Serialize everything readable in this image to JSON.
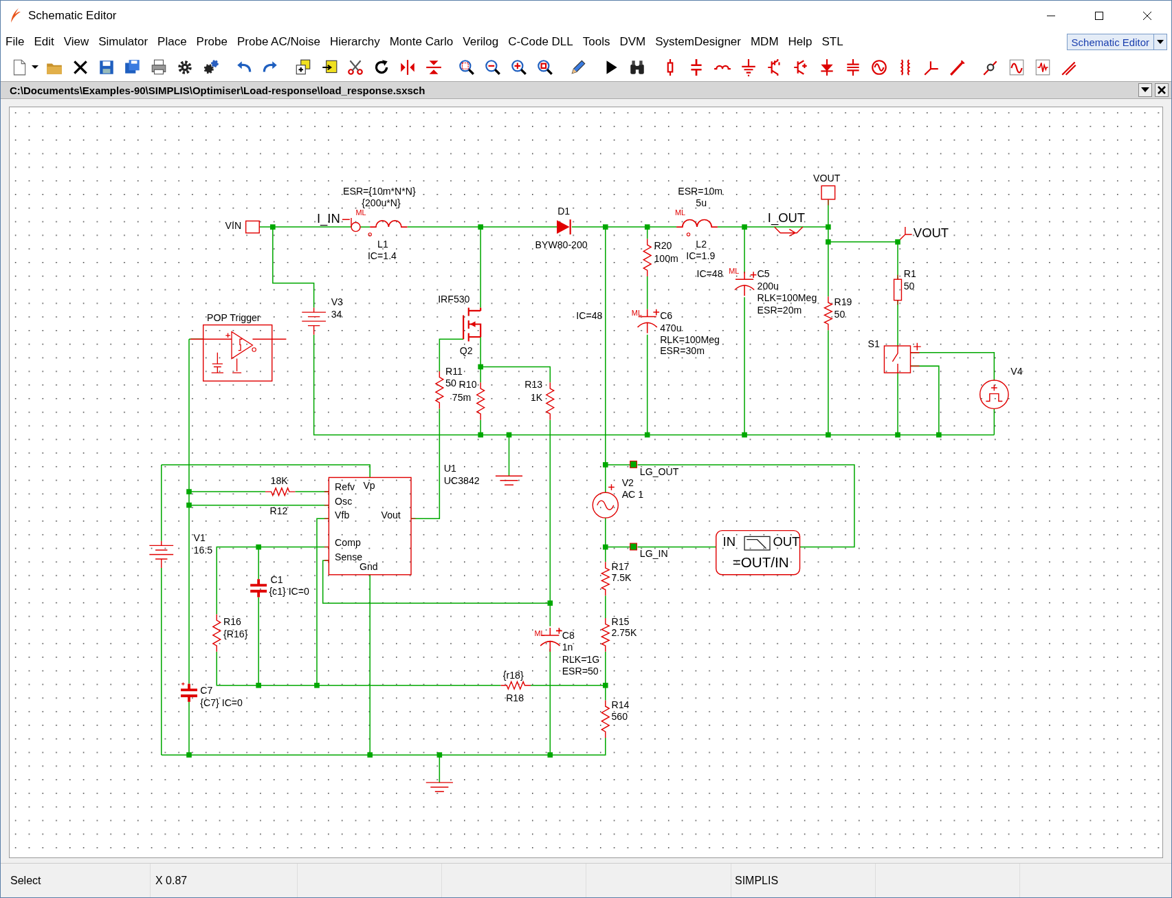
{
  "window": {
    "title": "Schematic Editor"
  },
  "menu": [
    "File",
    "Edit",
    "View",
    "Simulator",
    "Place",
    "Probe",
    "Probe AC/Noise",
    "Hierarchy",
    "Monte Carlo",
    "Verilog",
    "C-Code DLL",
    "Tools",
    "DVM",
    "SystemDesigner",
    "MDM",
    "Help",
    "STL"
  ],
  "mode_selector": {
    "value": "Schematic Editor"
  },
  "document": {
    "path": "C:\\Documents\\Examples-90\\SIMPLIS\\Optimiser\\Load-response\\load_response.sxsch"
  },
  "schematic": {
    "labels": [
      {
        "text": "VIN",
        "kind": "label"
      },
      {
        "text": "ESR={10m*N*N}",
        "kind": "label"
      },
      {
        "text": "{200u*N}",
        "kind": "label"
      },
      {
        "text": "I_IN",
        "kind": "net"
      },
      {
        "text": "ML",
        "kind": "ml"
      },
      {
        "text": "L1",
        "kind": "label"
      },
      {
        "text": "IC=1.4",
        "kind": "label"
      },
      {
        "text": "D1",
        "kind": "label"
      },
      {
        "text": "BYW80-200",
        "kind": "label"
      },
      {
        "text": "ESR=10m",
        "kind": "label"
      },
      {
        "text": "5u",
        "kind": "label"
      },
      {
        "text": "ML",
        "kind": "ml"
      },
      {
        "text": "L2",
        "kind": "label"
      },
      {
        "text": "IC=1.9",
        "kind": "label"
      },
      {
        "text": "VOUT",
        "kind": "label"
      },
      {
        "text": "I_OUT",
        "kind": "net"
      },
      {
        "text": "VOUT",
        "kind": "net"
      },
      {
        "text": "R20",
        "kind": "label"
      },
      {
        "text": "100m",
        "kind": "label"
      },
      {
        "text": "IC=48",
        "kind": "label"
      },
      {
        "text": "ML",
        "kind": "ml"
      },
      {
        "text": "C5",
        "kind": "label"
      },
      {
        "text": "200u",
        "kind": "label"
      },
      {
        "text": "RLK=100Meg",
        "kind": "label"
      },
      {
        "text": "ESR=20m",
        "kind": "label"
      },
      {
        "text": "R1",
        "kind": "label"
      },
      {
        "text": "50",
        "kind": "label"
      },
      {
        "text": "R19",
        "kind": "label"
      },
      {
        "text": "50",
        "kind": "label"
      },
      {
        "text": "S1",
        "kind": "label"
      },
      {
        "text": "V4",
        "kind": "label"
      },
      {
        "text": "V3",
        "kind": "label"
      },
      {
        "text": "34",
        "kind": "label"
      },
      {
        "text": "POP Trigger",
        "kind": "label"
      },
      {
        "text": "IRF530",
        "kind": "label"
      },
      {
        "text": "Q2",
        "kind": "label"
      },
      {
        "text": "IC=48",
        "kind": "label"
      },
      {
        "text": "ML",
        "kind": "ml"
      },
      {
        "text": "C6",
        "kind": "label"
      },
      {
        "text": "470u",
        "kind": "label"
      },
      {
        "text": "RLK=100Meg",
        "kind": "label"
      },
      {
        "text": "ESR=30m",
        "kind": "label"
      },
      {
        "text": "R11",
        "kind": "label"
      },
      {
        "text": "50",
        "kind": "label"
      },
      {
        "text": "R10",
        "kind": "label"
      },
      {
        "text": "75m",
        "kind": "label"
      },
      {
        "text": "R13",
        "kind": "label"
      },
      {
        "text": "1K",
        "kind": "label"
      },
      {
        "text": "U1",
        "kind": "label"
      },
      {
        "text": "UC3842",
        "kind": "label"
      },
      {
        "text": "LG_OUT",
        "kind": "label"
      },
      {
        "text": "18K",
        "kind": "label"
      },
      {
        "text": "R12",
        "kind": "label"
      },
      {
        "text": "Refv",
        "kind": "pin"
      },
      {
        "text": "Vp",
        "kind": "pin"
      },
      {
        "text": "Osc",
        "kind": "pin"
      },
      {
        "text": "Vfb",
        "kind": "pin"
      },
      {
        "text": "Vout",
        "kind": "pin"
      },
      {
        "text": "Comp",
        "kind": "pin"
      },
      {
        "text": "Sense",
        "kind": "pin"
      },
      {
        "text": "Gnd",
        "kind": "pin"
      },
      {
        "text": "V2",
        "kind": "label"
      },
      {
        "text": "AC 1",
        "kind": "label"
      },
      {
        "text": "V1",
        "kind": "label"
      },
      {
        "text": "16.5",
        "kind": "label"
      },
      {
        "text": "LG_IN",
        "kind": "label"
      },
      {
        "text": "IN",
        "kind": "block"
      },
      {
        "text": "OUT",
        "kind": "block"
      },
      {
        "text": "=OUT/IN",
        "kind": "block"
      },
      {
        "text": "R17",
        "kind": "label"
      },
      {
        "text": "7.5K",
        "kind": "label"
      },
      {
        "text": "C1",
        "kind": "label"
      },
      {
        "text": "{c1} IC=0",
        "kind": "label"
      },
      {
        "text": "R16",
        "kind": "label"
      },
      {
        "text": "{R16}",
        "kind": "label"
      },
      {
        "text": "R15",
        "kind": "label"
      },
      {
        "text": "ML",
        "kind": "ml"
      },
      {
        "text": "C8",
        "kind": "label"
      },
      {
        "text": "2.75K",
        "kind": "label"
      },
      {
        "text": "1n",
        "kind": "label"
      },
      {
        "text": "RLK=1G",
        "kind": "label"
      },
      {
        "text": "ESR=50",
        "kind": "label"
      },
      {
        "text": "{r18}",
        "kind": "label"
      },
      {
        "text": "R18",
        "kind": "label"
      },
      {
        "text": "C7",
        "kind": "label"
      },
      {
        "text": "{C7} IC=0",
        "kind": "label"
      },
      {
        "text": "R14",
        "kind": "label"
      },
      {
        "text": "560",
        "kind": "label"
      }
    ]
  },
  "status_bar": {
    "mode": "Select",
    "coordinate": "X 0.87",
    "simulator": "SIMPLIS"
  }
}
